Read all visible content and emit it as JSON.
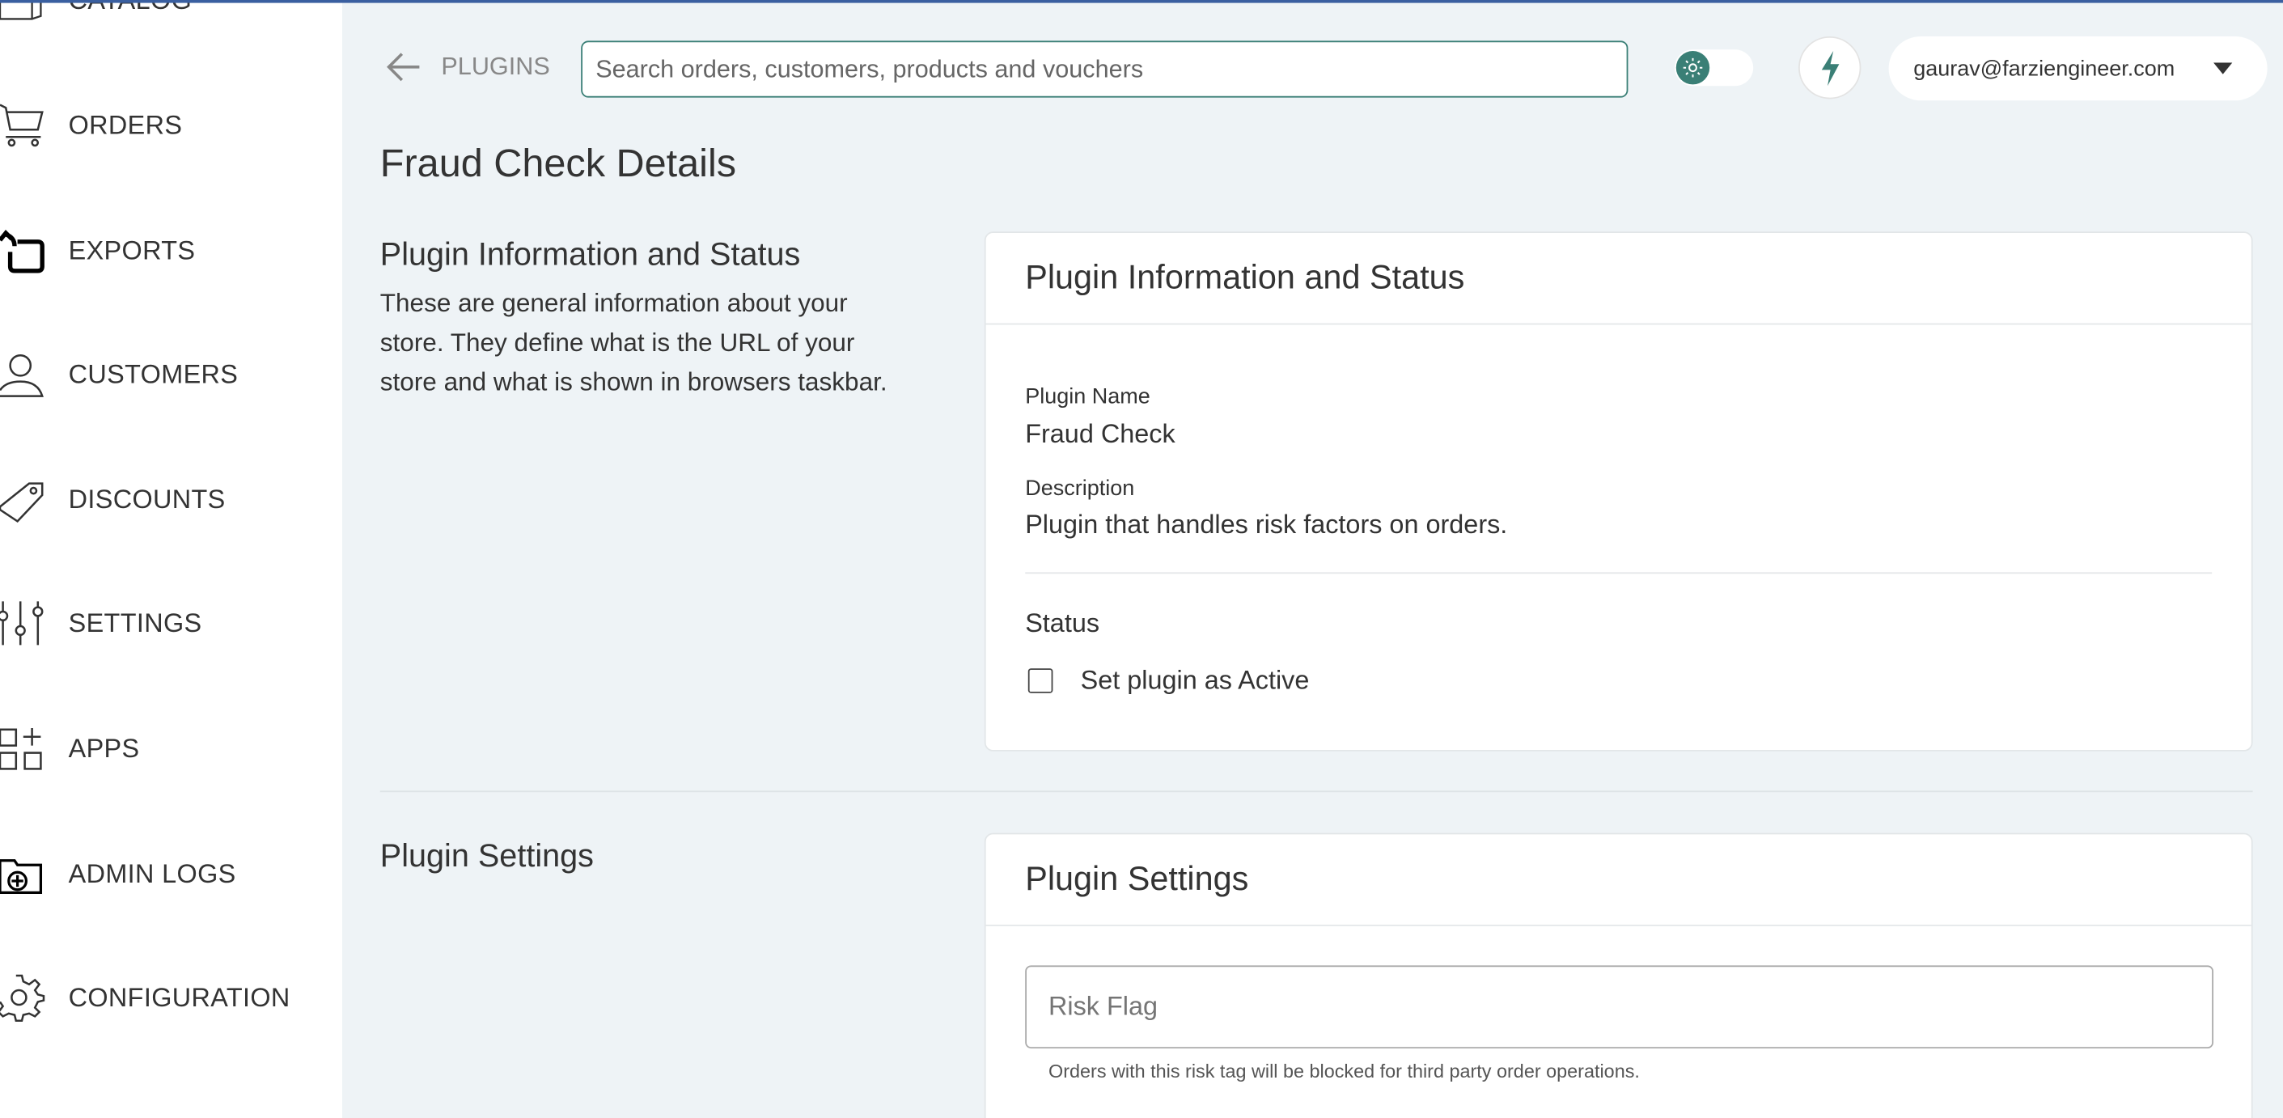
{
  "sidebar": {
    "items": [
      {
        "label": "CATALOG",
        "icon": "box-icon"
      },
      {
        "label": "ORDERS",
        "icon": "cart-icon"
      },
      {
        "label": "EXPORTS",
        "icon": "export-icon"
      },
      {
        "label": "CUSTOMERS",
        "icon": "user-icon"
      },
      {
        "label": "DISCOUNTS",
        "icon": "tag-icon"
      },
      {
        "label": "SETTINGS",
        "icon": "sliders-icon"
      },
      {
        "label": "APPS",
        "icon": "apps-icon"
      },
      {
        "label": "ADMIN LOGS",
        "icon": "folder-plus-icon"
      },
      {
        "label": "CONFIGURATION",
        "icon": "gear-icon"
      }
    ]
  },
  "header": {
    "back_label": "PLUGINS",
    "search_placeholder": "Search orders, customers, products and vouchers",
    "user_email": "gaurav@farziengineer.com"
  },
  "colors": {
    "accent": "#3a7f76",
    "topline": "#3a5fa0",
    "background": "#eef3f6"
  },
  "page": {
    "title": "Fraud Check Details",
    "info_section": {
      "heading": "Plugin Information and Status",
      "description_lines": [
        "These are general information about your",
        "store. They define what is the URL of your",
        "store and what is shown in browsers taskbar."
      ],
      "card_title": "Plugin Information and Status",
      "name_label": "Plugin Name",
      "name_value": "Fraud Check",
      "desc_label": "Description",
      "desc_value": "Plugin that handles risk factors on orders.",
      "status_label": "Status",
      "active_label": "Set plugin as Active",
      "active_checked": false
    },
    "settings_section": {
      "heading": "Plugin Settings",
      "card_title": "Plugin Settings",
      "risk_flag_placeholder": "Risk Flag",
      "risk_flag_value": "",
      "risk_flag_help": "Orders with this risk tag will be blocked for third party order operations."
    }
  }
}
